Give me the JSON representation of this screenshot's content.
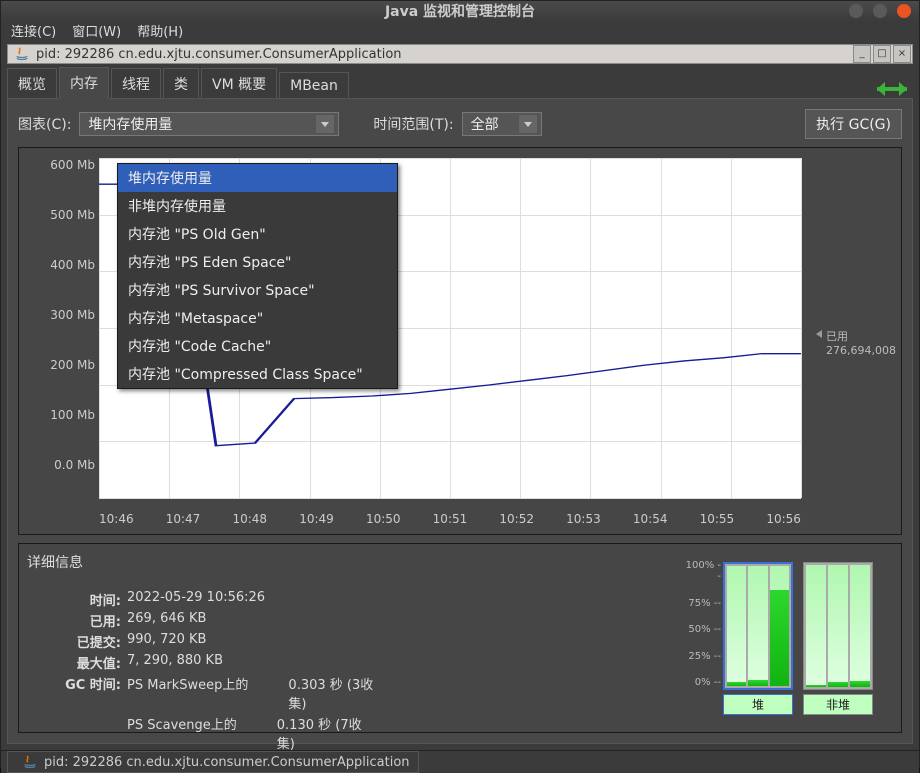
{
  "window_title": "Java 监视和管理控制台",
  "menus": {
    "connect": "连接(C)",
    "window": "窗口(W)",
    "help": "帮助(H)"
  },
  "subwindow_title": "pid: 292286 cn.edu.xjtu.consumer.ConsumerApplication",
  "tabs": {
    "overview": "概览",
    "memory": "内存",
    "threads": "线程",
    "classes": "类",
    "vm": "VM 概要",
    "mbean": "MBean"
  },
  "controls": {
    "chart_label": "图表(C):",
    "chart_selected": "堆内存使用量",
    "time_range_label": "时间范围(T):",
    "time_range_selected": "全部",
    "perform_gc": "执行 GC(G)"
  },
  "dropdown_options": [
    "堆内存使用量",
    "非堆内存使用量",
    "内存池 \"PS Old Gen\"",
    "内存池 \"PS Eden Space\"",
    "内存池 \"PS Survivor Space\"",
    "内存池 \"Metaspace\"",
    "内存池 \"Code Cache\"",
    "内存池 \"Compressed Class Space\""
  ],
  "chart_data": {
    "type": "line",
    "title": "",
    "xlabel": "",
    "ylabel": "",
    "ylim": [
      0,
      650
    ],
    "y_ticks": [
      "600 Mb",
      "500 Mb",
      "400 Mb",
      "300 Mb",
      "200 Mb",
      "100 Mb",
      "0.0 Mb"
    ],
    "x_ticks": [
      "10:46",
      "10:47",
      "10:48",
      "10:49",
      "10:50",
      "10:51",
      "10:52",
      "10:53",
      "10:54",
      "10:55",
      "10:56"
    ],
    "series": [
      {
        "name": "已用",
        "points_mb": [
          600,
          600,
          600,
          100,
          105,
          190,
          192,
          195,
          200,
          208,
          216,
          225,
          234,
          244,
          254,
          262,
          268,
          276,
          276
        ]
      }
    ],
    "end_label": {
      "name": "已用",
      "value": "276,694,008"
    }
  },
  "details": {
    "title": "详细信息",
    "time_k": "时间:",
    "time_v": "2022-05-29 10:56:26",
    "used_k": "已用:",
    "used_v": "269, 646 KB",
    "committed_k": "已提交:",
    "committed_v": "990, 720 KB",
    "max_k": "最大值:",
    "max_v": "7, 290, 880 KB",
    "gc_k": "GC 时间:",
    "gc1_name": "PS MarkSweep上的",
    "gc1_time": "0.303 秒 (3收集)",
    "gc2_name": "PS Scavenge上的",
    "gc2_time": "0.130 秒 (7收集)"
  },
  "bars": {
    "scale": [
      "100% --",
      "75% --",
      "50% --",
      "25% --",
      "0% --"
    ],
    "heap_label": "堆",
    "nonheap_label": "非堆",
    "heap_fills_pct": [
      3,
      5,
      80
    ],
    "nonheap_fills_pct": [
      2,
      4,
      5
    ]
  },
  "taskbar_item": "pid: 292286 cn.edu.xjtu.consumer.ConsumerApplication"
}
